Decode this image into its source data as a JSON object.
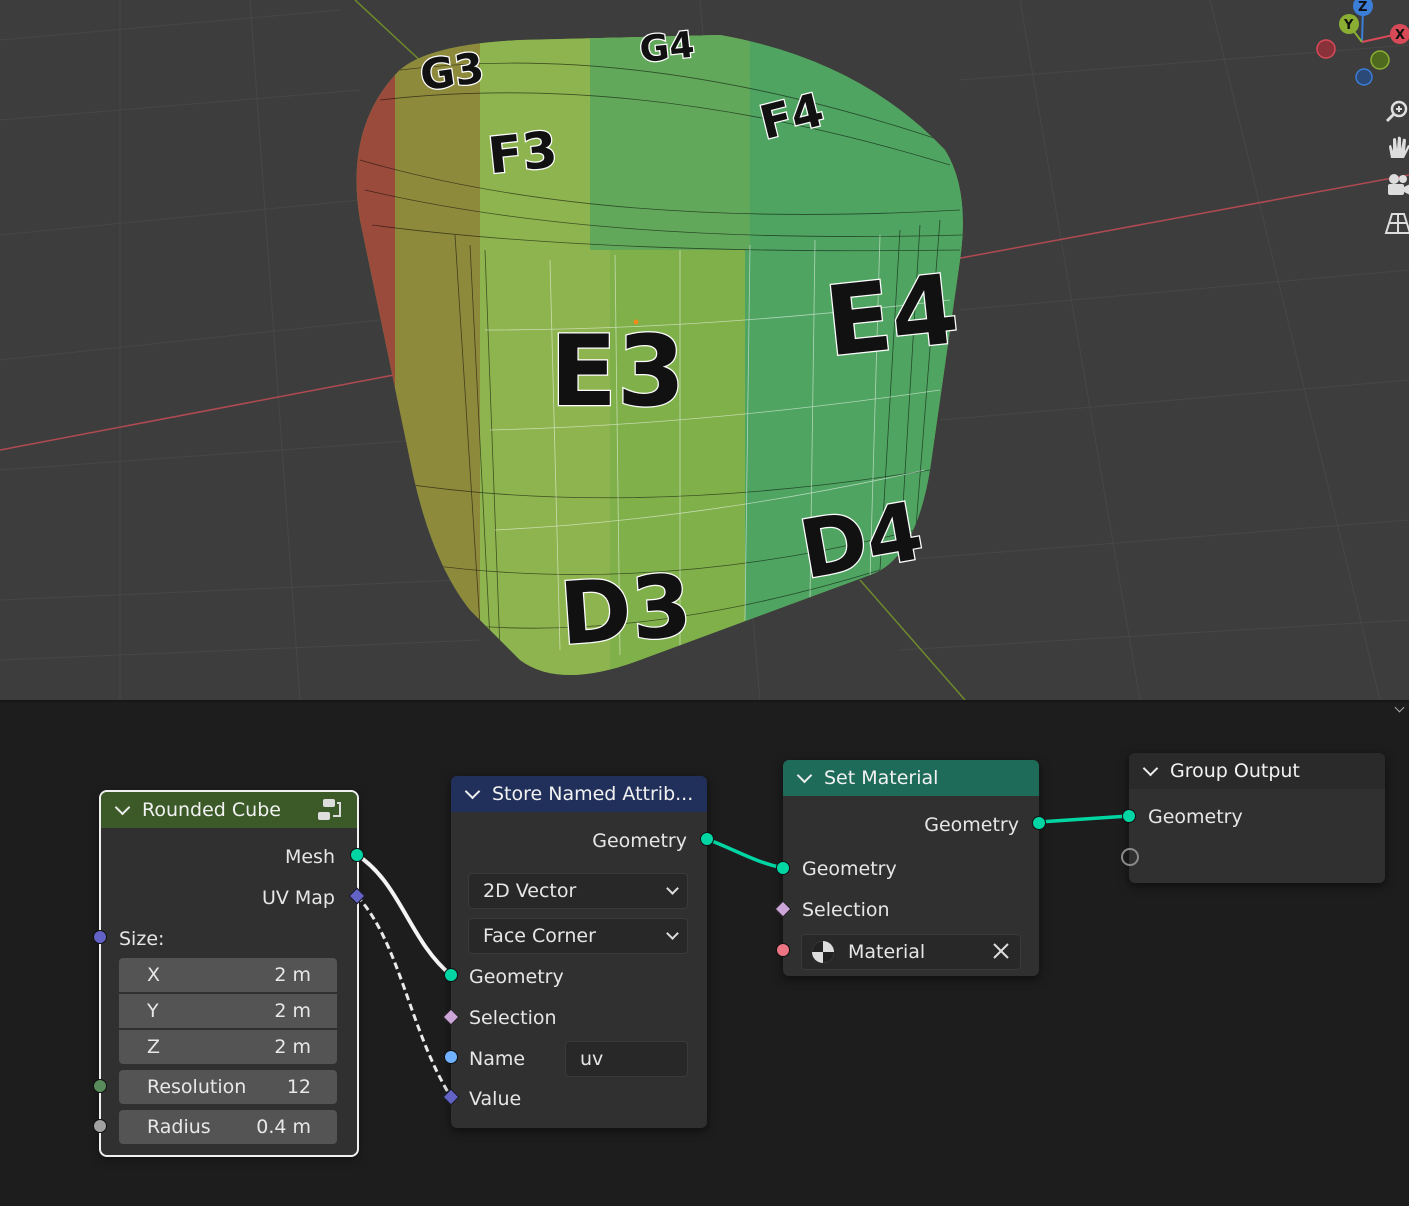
{
  "viewport": {
    "cube_labels": [
      "G3",
      "G4",
      "F3",
      "F4",
      "E3",
      "E4",
      "D3",
      "D4"
    ],
    "gizmo": {
      "z_label": "Z",
      "y_label": "Y",
      "x_label": "X"
    },
    "nav_icons": [
      "zoom-icon",
      "pan-hand-icon",
      "camera-icon",
      "perspective-grid-icon"
    ]
  },
  "nodes": {
    "rounded_cube": {
      "title": "Rounded Cube",
      "outputs": [
        "Mesh",
        "UV Map"
      ],
      "size_label": "Size:",
      "x": {
        "label": "X",
        "value": "2 m"
      },
      "y": {
        "label": "Y",
        "value": "2 m"
      },
      "z": {
        "label": "Z",
        "value": "2 m"
      },
      "resolution": {
        "label": "Resolution",
        "value": "12"
      },
      "radius": {
        "label": "Radius",
        "value": "0.4 m"
      }
    },
    "store_named_attribute": {
      "title": "Store Named Attrib...",
      "output": "Geometry",
      "data_type": "2D Vector",
      "domain": "Face Corner",
      "geometry": "Geometry",
      "selection": "Selection",
      "name_label": "Name",
      "name_value": "uv",
      "value": "Value"
    },
    "set_material": {
      "title": "Set Material",
      "output": "Geometry",
      "geometry": "Geometry",
      "selection": "Selection",
      "material": "Material"
    },
    "group_output": {
      "title": "Group Output",
      "geometry": "Geometry"
    }
  },
  "colors": {
    "geometry_socket": "#00d6a3",
    "vector_socket": "#6363c7",
    "bool_socket": "#cca6d6",
    "string_socket": "#70b2ff",
    "int_socket": "#598c5c",
    "float_socket": "#a1a1a1",
    "material_socket": "#eb7582",
    "header_geometry_group": "#3b5a28",
    "header_attribute": "#21305a",
    "header_set_material": "#1e6b5a",
    "header_output": "#2a2a2a"
  }
}
